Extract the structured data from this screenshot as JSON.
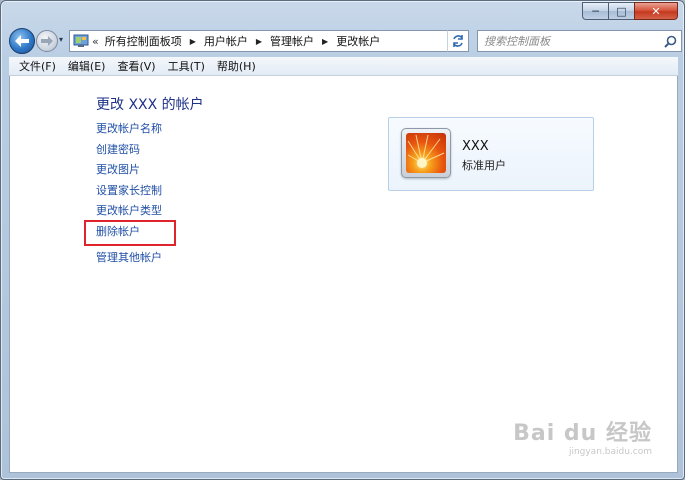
{
  "window": {
    "caption_buttons": {
      "minimize": "─",
      "maximize": "□",
      "close": "✕"
    }
  },
  "navbar": {
    "back_icon": "back-arrow-icon",
    "forward_icon": "forward-arrow-icon",
    "history_dropdown": "▾",
    "address": {
      "overflow_chevron": "«",
      "breadcrumbs": [
        "所有控制面板项",
        "用户帐户",
        "管理帐户",
        "更改帐户"
      ],
      "separator": "▶",
      "dropdown": "▾"
    },
    "refresh_icon": "refresh-icon",
    "search": {
      "placeholder": "搜索控制面板",
      "icon": "search-icon"
    }
  },
  "menubar": {
    "items": [
      "文件(F)",
      "编辑(E)",
      "查看(V)",
      "工具(T)",
      "帮助(H)"
    ]
  },
  "main": {
    "title": "更改 XXX 的帐户",
    "tasks": [
      "更改帐户名称",
      "创建密码",
      "更改图片",
      "设置家长控制",
      "更改帐户类型",
      "删除帐户"
    ],
    "other_link": "管理其他帐户",
    "highlighted_task": "删除帐户",
    "highlight_color": "#e0242c",
    "link_color": "#1f4fa6",
    "title_color": "#1e3287"
  },
  "account": {
    "name": "XXX",
    "type": "标准用户",
    "avatar_icon": "flower-avatar-icon"
  },
  "watermark": {
    "logo": "Bai du 经验",
    "url": "jingyan.baidu.com"
  }
}
